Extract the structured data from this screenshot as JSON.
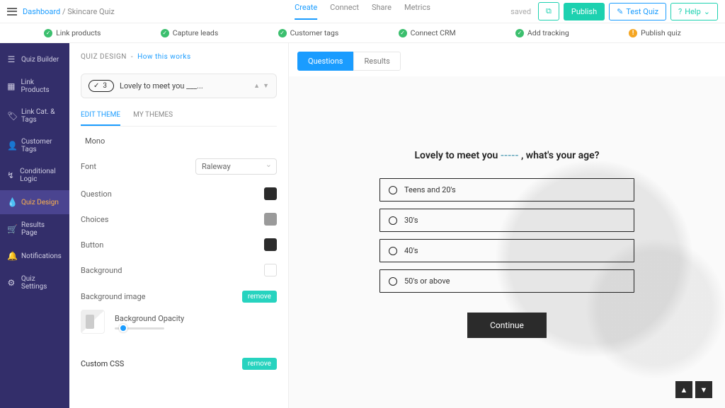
{
  "header": {
    "breadcrumb_dashboard": "Dashboard",
    "breadcrumb_current": "Skincare Quiz",
    "nav": {
      "create": "Create",
      "connect": "Connect",
      "share": "Share",
      "metrics": "Metrics"
    },
    "saved_label": "saved",
    "publish": "Publish",
    "test_quiz": "Test Quiz",
    "help": "Help"
  },
  "steps": {
    "link_products": "Link products",
    "capture_leads": "Capture leads",
    "customer_tags": "Customer tags",
    "connect_crm": "Connect CRM",
    "add_tracking": "Add tracking",
    "publish_quiz": "Publish quiz"
  },
  "sidebar": {
    "items": [
      {
        "label": "Quiz Builder"
      },
      {
        "label": "Link Products"
      },
      {
        "label": "Link Cat. & Tags"
      },
      {
        "label": "Customer Tags"
      },
      {
        "label": "Conditional Logic"
      },
      {
        "label": "Quiz Design"
      },
      {
        "label": "Results Page"
      },
      {
        "label": "Notifications"
      },
      {
        "label": "Quiz Settings"
      }
    ]
  },
  "panel": {
    "title": "QUIZ DESIGN",
    "how": "How this works",
    "question_number": "3",
    "question_text": "Lovely to meet you ___...",
    "tabs": {
      "edit": "EDIT THEME",
      "my": "MY THEMES"
    },
    "theme_name": "Mono",
    "font_label": "Font",
    "font_value": "Raleway",
    "question_label": "Question",
    "choices_label": "Choices",
    "button_label": "Button",
    "background_label": "Background",
    "bg_image_label": "Background image",
    "bg_opacity_label": "Background Opacity",
    "remove": "remove",
    "custom_css": "Custom CSS"
  },
  "preview": {
    "tab_questions": "Questions",
    "tab_results": "Results",
    "question_pre": "Lovely to meet you ",
    "question_blank": "-----",
    "question_post": " , what's your age?",
    "choices": [
      "Teens and 20's",
      "30's",
      "40's",
      "50's or above"
    ],
    "continue": "Continue"
  },
  "colors": {
    "accent": "#1a9cff",
    "teal": "#1dd1b0",
    "sidebar": "#332e6a",
    "sidebar_active": "#4a4490",
    "active_orange": "#ffb34d"
  }
}
